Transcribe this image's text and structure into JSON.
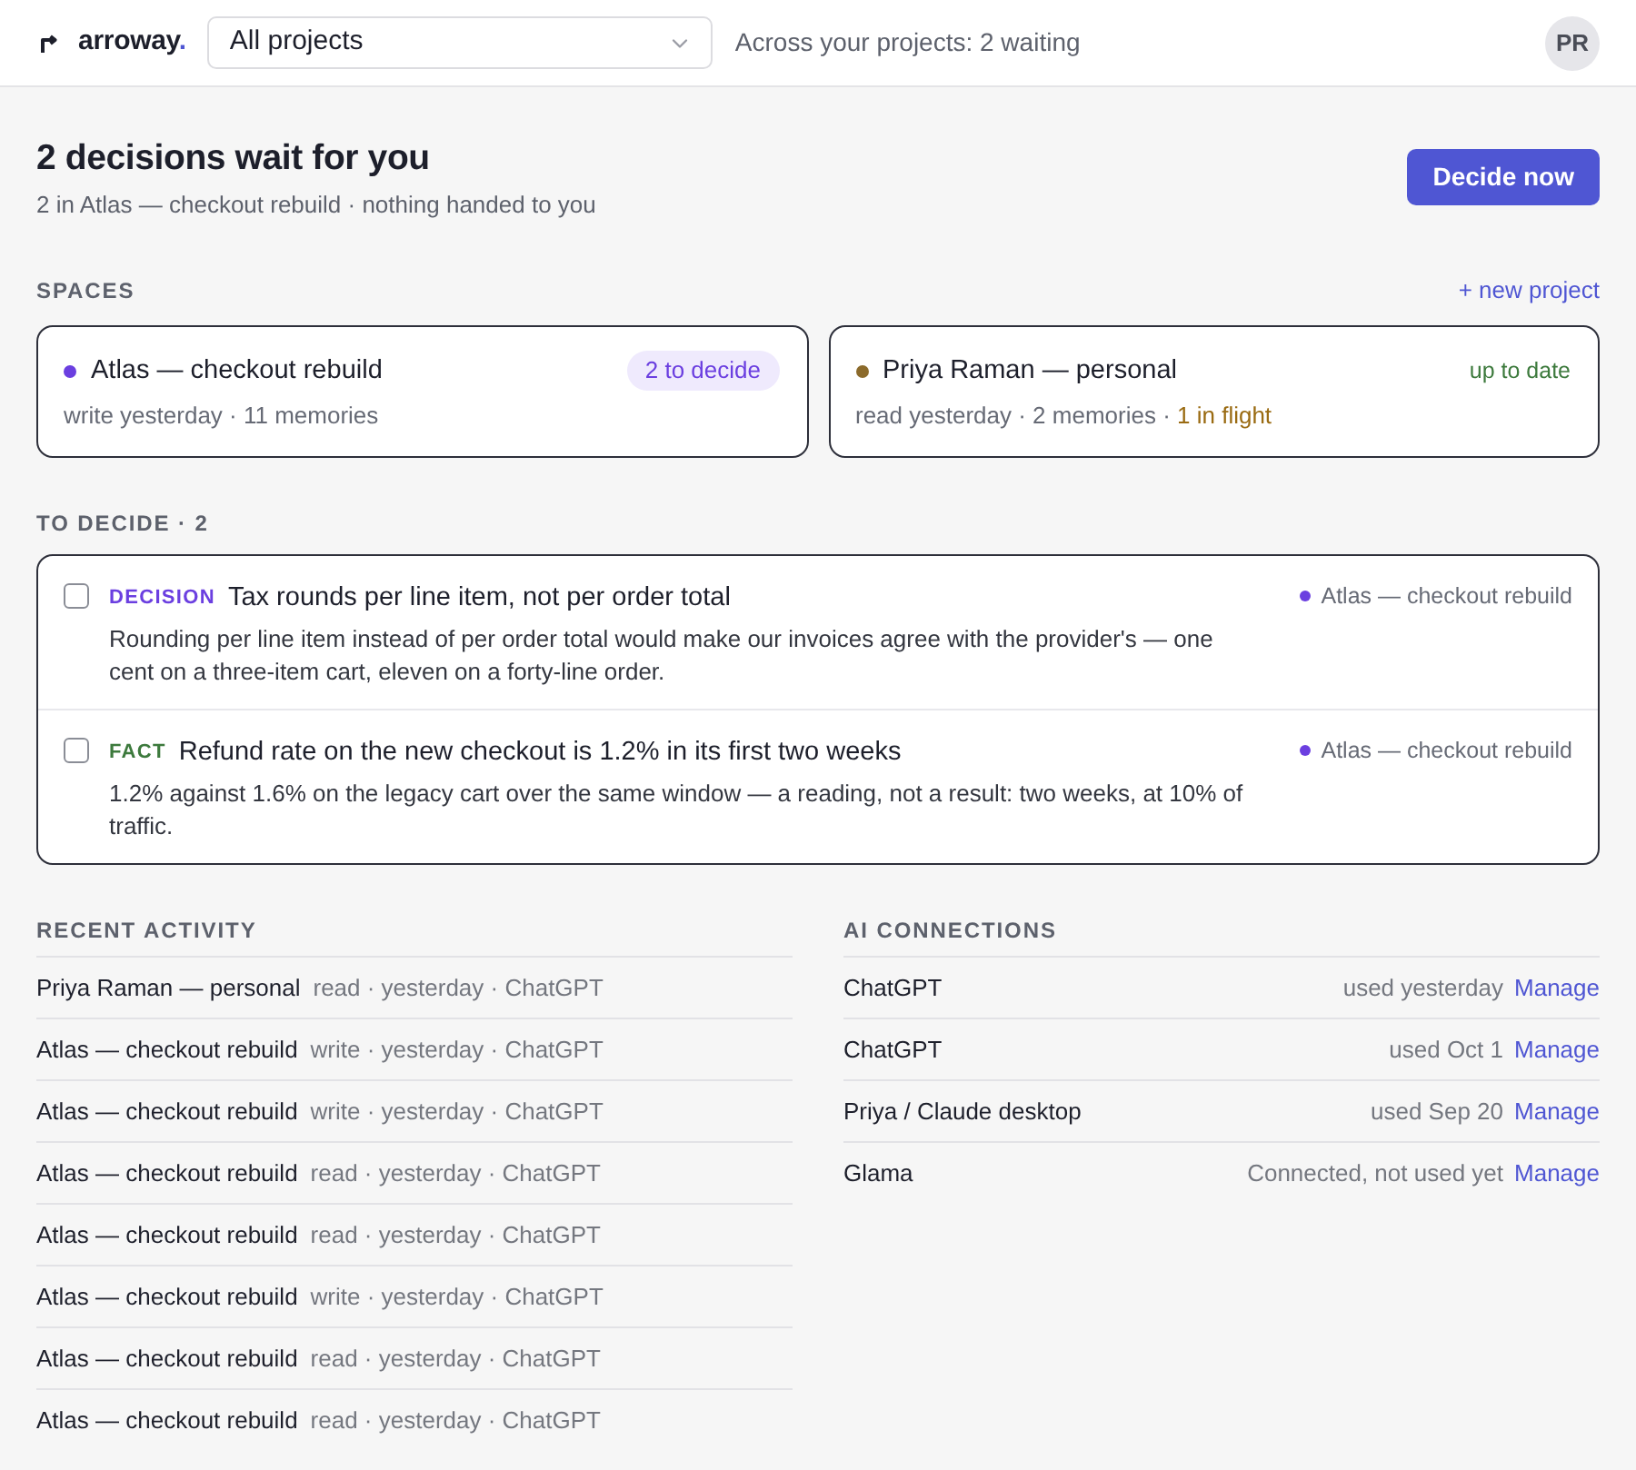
{
  "header": {
    "brand": {
      "name": "arroway",
      "dot": "."
    },
    "project_select": {
      "value": "All projects"
    },
    "summary": "Across your projects: 2 waiting",
    "avatar": "PR"
  },
  "hero": {
    "title": "2 decisions wait for you",
    "subtitle": "2 in Atlas — checkout rebuild · nothing handed to you",
    "button": "Decide now"
  },
  "spaces": {
    "heading": "SPACES",
    "action": "+ new project",
    "items": [
      {
        "name": "Atlas — checkout rebuild",
        "color": "#6b3fe0",
        "status": {
          "kind": "pending",
          "text": "2 to decide"
        },
        "meta": [
          {
            "text": "write yesterday · 11 memories",
            "warning": false
          }
        ]
      },
      {
        "name": "Priya Raman — personal",
        "color": "#8b6a2b",
        "status": {
          "kind": "ok",
          "text": "up to date"
        },
        "meta": [
          {
            "text": "read yesterday · 2 memories · ",
            "warning": false
          },
          {
            "text": "1 in flight",
            "warning": true
          }
        ]
      }
    ]
  },
  "to_decide": {
    "heading": "TO DECIDE · 2",
    "items": [
      {
        "kind": "decision",
        "kind_label": "DECISION",
        "checked": false,
        "title": "Tax rounds per line item, not per order total",
        "body": "Rounding per line item instead of per order total would make our invoices agree with the provider's — one cent on a three-item cart, eleven on a forty-line order.",
        "space": "Atlas — checkout rebuild",
        "color": "#6b3fe0"
      },
      {
        "kind": "fact",
        "kind_label": "FACT",
        "checked": false,
        "title": "Refund rate on the new checkout is 1.2% in its first two weeks",
        "body": "1.2% against 1.6% on the legacy cart over the same window — a reading, not a result: two weeks, at 10% of traffic.",
        "space": "Atlas — checkout rebuild",
        "color": "#6b3fe0"
      }
    ]
  },
  "recent_activity": {
    "heading": "RECENT ACTIVITY",
    "rows": [
      {
        "space": "Priya Raman — personal",
        "detail": "read · yesterday · ChatGPT"
      },
      {
        "space": "Atlas — checkout rebuild",
        "detail": "write · yesterday · ChatGPT"
      },
      {
        "space": "Atlas — checkout rebuild",
        "detail": "write · yesterday · ChatGPT"
      },
      {
        "space": "Atlas — checkout rebuild",
        "detail": "read · yesterday · ChatGPT"
      },
      {
        "space": "Atlas — checkout rebuild",
        "detail": "read · yesterday · ChatGPT"
      },
      {
        "space": "Atlas — checkout rebuild",
        "detail": "write · yesterday · ChatGPT"
      },
      {
        "space": "Atlas — checkout rebuild",
        "detail": "read · yesterday · ChatGPT"
      },
      {
        "space": "Atlas — checkout rebuild",
        "detail": "read · yesterday · ChatGPT"
      }
    ]
  },
  "ai_connections": {
    "heading": "AI CONNECTIONS",
    "rows": [
      {
        "name": "ChatGPT",
        "status": "used yesterday",
        "action": "Manage"
      },
      {
        "name": "ChatGPT",
        "status": "used Oct 1",
        "action": "Manage"
      },
      {
        "name": "Priya / Claude desktop",
        "status": "used Sep 20",
        "action": "Manage"
      },
      {
        "name": "Glama",
        "status": "Connected, not used yet",
        "action": "Manage"
      }
    ]
  }
}
